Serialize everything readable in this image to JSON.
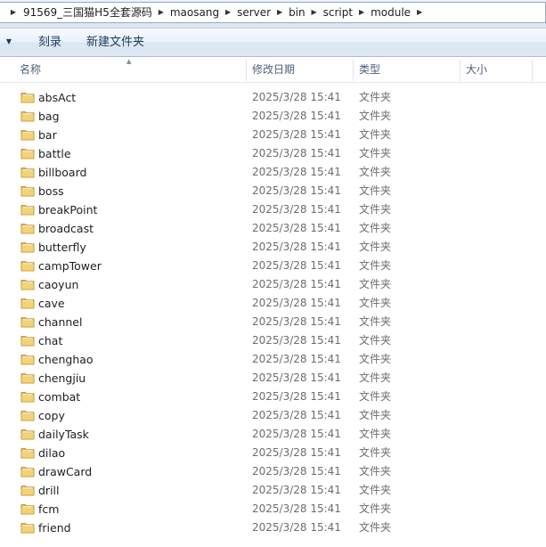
{
  "address": {
    "crumbs": [
      "91569_三国猫H5全套源码",
      "maosang",
      "server",
      "bin",
      "script",
      "module"
    ]
  },
  "toolbar": {
    "dropdown_icon": "chevron-down-icon",
    "burn_label": "刻录",
    "new_folder_label": "新建文件夹"
  },
  "columns": {
    "name": "名称",
    "modified": "修改日期",
    "type": "类型",
    "size": "大小"
  },
  "folder_icon": "folder-icon",
  "files": [
    {
      "name": "absAct",
      "modified": "2025/3/28 15:41",
      "type": "文件夹"
    },
    {
      "name": "bag",
      "modified": "2025/3/28 15:41",
      "type": "文件夹"
    },
    {
      "name": "bar",
      "modified": "2025/3/28 15:41",
      "type": "文件夹"
    },
    {
      "name": "battle",
      "modified": "2025/3/28 15:41",
      "type": "文件夹"
    },
    {
      "name": "billboard",
      "modified": "2025/3/28 15:41",
      "type": "文件夹"
    },
    {
      "name": "boss",
      "modified": "2025/3/28 15:41",
      "type": "文件夹"
    },
    {
      "name": "breakPoint",
      "modified": "2025/3/28 15:41",
      "type": "文件夹"
    },
    {
      "name": "broadcast",
      "modified": "2025/3/28 15:41",
      "type": "文件夹"
    },
    {
      "name": "butterfly",
      "modified": "2025/3/28 15:41",
      "type": "文件夹"
    },
    {
      "name": "campTower",
      "modified": "2025/3/28 15:41",
      "type": "文件夹"
    },
    {
      "name": "caoyun",
      "modified": "2025/3/28 15:41",
      "type": "文件夹"
    },
    {
      "name": "cave",
      "modified": "2025/3/28 15:41",
      "type": "文件夹"
    },
    {
      "name": "channel",
      "modified": "2025/3/28 15:41",
      "type": "文件夹"
    },
    {
      "name": "chat",
      "modified": "2025/3/28 15:41",
      "type": "文件夹"
    },
    {
      "name": "chenghao",
      "modified": "2025/3/28 15:41",
      "type": "文件夹"
    },
    {
      "name": "chengjiu",
      "modified": "2025/3/28 15:41",
      "type": "文件夹"
    },
    {
      "name": "combat",
      "modified": "2025/3/28 15:41",
      "type": "文件夹"
    },
    {
      "name": "copy",
      "modified": "2025/3/28 15:41",
      "type": "文件夹"
    },
    {
      "name": "dailyTask",
      "modified": "2025/3/28 15:41",
      "type": "文件夹"
    },
    {
      "name": "dilao",
      "modified": "2025/3/28 15:41",
      "type": "文件夹"
    },
    {
      "name": "drawCard",
      "modified": "2025/3/28 15:41",
      "type": "文件夹"
    },
    {
      "name": "drill",
      "modified": "2025/3/28 15:41",
      "type": "文件夹"
    },
    {
      "name": "fcm",
      "modified": "2025/3/28 15:41",
      "type": "文件夹"
    },
    {
      "name": "friend",
      "modified": "2025/3/28 15:41",
      "type": "文件夹"
    }
  ]
}
